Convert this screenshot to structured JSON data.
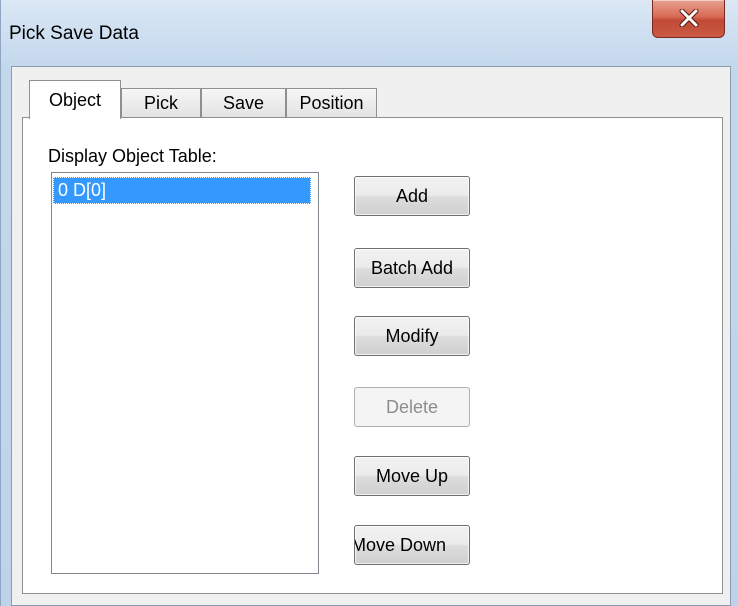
{
  "window": {
    "title": "Pick Save Data"
  },
  "tabs": [
    {
      "label": "Object",
      "active": true
    },
    {
      "label": "Pick",
      "active": false
    },
    {
      "label": "Save",
      "active": false
    },
    {
      "label": "Position",
      "active": false
    }
  ],
  "object_tab": {
    "list_label": "Display Object Table:",
    "items": [
      {
        "text": "0  D[0]",
        "selected": true
      }
    ],
    "buttons": {
      "add": "Add",
      "batch_add": "Batch Add",
      "modify": "Modify",
      "delete": "Delete",
      "move_up": "Move Up",
      "move_down": "Move Down"
    }
  },
  "colors": {
    "selection": "#3399ff",
    "close_button": "#c95a43"
  }
}
